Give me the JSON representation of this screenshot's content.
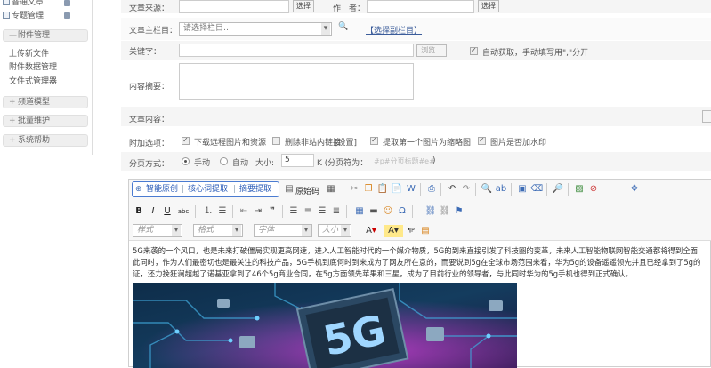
{
  "sidebar": {
    "items_top": [
      {
        "label": "普通文章"
      },
      {
        "label": "专题管理"
      }
    ],
    "sections": [
      {
        "label": "附件管理"
      },
      {
        "label": "频道模型"
      },
      {
        "label": "批量维护"
      },
      {
        "label": "系统帮助"
      }
    ],
    "attachment_items": [
      {
        "label": "上传新文件"
      },
      {
        "label": "附件数据管理"
      },
      {
        "label": "文件式管理器"
      }
    ]
  },
  "form": {
    "source_label": "文章来源：",
    "source_select_btn": "选择",
    "author_label": "作　者：",
    "author_select_btn": "选择",
    "column_label": "文章主栏目：",
    "column_select_value": "请选择栏目…",
    "column_sub_link": "【选择副栏目】",
    "keywords_label": "关键字：",
    "keywords_browse_btn": "浏览...",
    "auto_keywords_text": "自动获取，手动填写用\",\"分开",
    "summary_label": "内容摘要：",
    "content_label": "文章内容：",
    "options_label": "附加选项：",
    "opt_download": "下载远程图片和资源",
    "opt_remove_links": "删除非站内链接",
    "opt_settings": "[设置]",
    "opt_first_image": "提取第一个图片为缩略图",
    "opt_watermark": "图片是否加水印",
    "paging_label": "分页方式：",
    "paging_manual": "手动",
    "paging_auto": "自动",
    "paging_size_label": "大小:",
    "paging_size_value": "5",
    "paging_unit": "K (分页符为：",
    "paging_marker": "#p#分页标题#e#",
    "paging_close": ")"
  },
  "editor": {
    "ai_buttons": [
      "智能原创",
      "核心词提取",
      "摘要提取"
    ],
    "source_btn": "原始码",
    "style_dropdowns": [
      "样式",
      "格式",
      "字体",
      "大小"
    ],
    "content_lines": [
      "5G来袭的一个风口，也是未来打破僵局实现更高网速，进入人工智能时代的一个媒介物质，5G的到来直接引发了科技圈的变革，未来人工智能物联网智能交通都将得到全面",
      "此同时，作为人们最密切也是最关注的科技产品，5G手机到底何时到来成为了网友所在意的，而要说到5g在全球市场范围来看，华为5g的设备遥遥领先并且已经拿到了5g的",
      "证，还力挽狂澜超越了诺基亚拿到了46个5g商业合同，在5g方面领先苹果和三星，成为了目前行业的领导者，与此同时华为的5g手机也得到正式确认。"
    ],
    "image_caption": "5G"
  }
}
